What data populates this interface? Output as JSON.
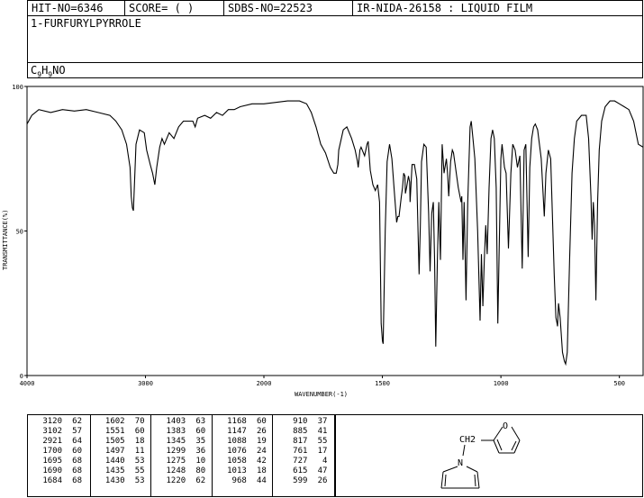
{
  "header": {
    "hit_no": "HIT-NO=6346",
    "score": "SCORE=  (  )",
    "sdbs_no": "SDBS-NO=22523",
    "ir_info": "IR-NIDA-26158 : LIQUID FILM"
  },
  "compound": {
    "name": "1-FURFURYLPYRROLE",
    "formula_parts": [
      "C",
      "9",
      "H",
      "9",
      "NO"
    ]
  },
  "chart_data": {
    "type": "line",
    "title": "",
    "xlabel": "WAVENUMBER(-1)",
    "ylabel": "TRANSMITTANCE(%)",
    "xlim": [
      4000,
      400
    ],
    "ylim": [
      0,
      100
    ],
    "x_ticks": [
      4000,
      3000,
      2000,
      1500,
      1000,
      500
    ],
    "y_ticks": [
      0,
      50,
      100
    ],
    "grid": false,
    "series": [
      {
        "points": [
          [
            4000,
            87
          ],
          [
            3960,
            90
          ],
          [
            3900,
            92
          ],
          [
            3800,
            91
          ],
          [
            3700,
            92
          ],
          [
            3600,
            91.5
          ],
          [
            3500,
            92
          ],
          [
            3400,
            91
          ],
          [
            3300,
            90
          ],
          [
            3250,
            88
          ],
          [
            3200,
            85
          ],
          [
            3160,
            80
          ],
          [
            3130,
            72
          ],
          [
            3120,
            62
          ],
          [
            3110,
            58
          ],
          [
            3102,
            57
          ],
          [
            3095,
            64
          ],
          [
            3080,
            80
          ],
          [
            3050,
            85
          ],
          [
            3010,
            84
          ],
          [
            2990,
            78
          ],
          [
            2960,
            73
          ],
          [
            2940,
            70
          ],
          [
            2921,
            66
          ],
          [
            2905,
            72
          ],
          [
            2880,
            79
          ],
          [
            2860,
            82
          ],
          [
            2840,
            80
          ],
          [
            2800,
            84
          ],
          [
            2760,
            82
          ],
          [
            2720,
            86
          ],
          [
            2680,
            88
          ],
          [
            2640,
            88
          ],
          [
            2600,
            88
          ],
          [
            2580,
            86
          ],
          [
            2560,
            89
          ],
          [
            2500,
            90
          ],
          [
            2450,
            89
          ],
          [
            2400,
            91
          ],
          [
            2350,
            90
          ],
          [
            2300,
            92
          ],
          [
            2250,
            92
          ],
          [
            2200,
            93
          ],
          [
            2100,
            94
          ],
          [
            2000,
            94
          ],
          [
            1950,
            94.5
          ],
          [
            1900,
            95
          ],
          [
            1850,
            95
          ],
          [
            1820,
            94
          ],
          [
            1800,
            91
          ],
          [
            1780,
            86
          ],
          [
            1760,
            80
          ],
          [
            1740,
            77
          ],
          [
            1720,
            72
          ],
          [
            1705,
            70
          ],
          [
            1700,
            70
          ],
          [
            1695,
            70
          ],
          [
            1688,
            73
          ],
          [
            1684,
            78
          ],
          [
            1665,
            85
          ],
          [
            1650,
            86
          ],
          [
            1630,
            82
          ],
          [
            1615,
            78
          ],
          [
            1605,
            74
          ],
          [
            1602,
            72
          ],
          [
            1595,
            78
          ],
          [
            1590,
            79
          ],
          [
            1575,
            76
          ],
          [
            1565,
            80
          ],
          [
            1560,
            81
          ],
          [
            1551,
            71
          ],
          [
            1540,
            66
          ],
          [
            1530,
            64
          ],
          [
            1520,
            66
          ],
          [
            1512,
            60
          ],
          [
            1505,
            18
          ],
          [
            1500,
            12
          ],
          [
            1497,
            11
          ],
          [
            1488,
            50
          ],
          [
            1480,
            74
          ],
          [
            1470,
            80
          ],
          [
            1460,
            75
          ],
          [
            1450,
            64
          ],
          [
            1440,
            53
          ],
          [
            1435,
            55
          ],
          [
            1430,
            55
          ],
          [
            1420,
            62
          ],
          [
            1415,
            65
          ],
          [
            1410,
            70
          ],
          [
            1405,
            69
          ],
          [
            1403,
            63
          ],
          [
            1398,
            65
          ],
          [
            1390,
            69
          ],
          [
            1385,
            67
          ],
          [
            1383,
            60
          ],
          [
            1375,
            73
          ],
          [
            1365,
            73
          ],
          [
            1355,
            68
          ],
          [
            1345,
            35
          ],
          [
            1340,
            52
          ],
          [
            1335,
            74
          ],
          [
            1325,
            80
          ],
          [
            1315,
            79
          ],
          [
            1305,
            56
          ],
          [
            1299,
            36
          ],
          [
            1292,
            56
          ],
          [
            1285,
            60
          ],
          [
            1280,
            40
          ],
          [
            1275,
            10
          ],
          [
            1268,
            40
          ],
          [
            1262,
            60
          ],
          [
            1255,
            40
          ],
          [
            1248,
            80
          ],
          [
            1240,
            70
          ],
          [
            1230,
            75
          ],
          [
            1225,
            70
          ],
          [
            1220,
            62
          ],
          [
            1212,
            74
          ],
          [
            1205,
            78
          ],
          [
            1200,
            77
          ],
          [
            1180,
            65
          ],
          [
            1168,
            60
          ],
          [
            1165,
            62
          ],
          [
            1160,
            40
          ],
          [
            1155,
            60
          ],
          [
            1147,
            26
          ],
          [
            1140,
            60
          ],
          [
            1130,
            86
          ],
          [
            1125,
            88
          ],
          [
            1118,
            82
          ],
          [
            1110,
            75
          ],
          [
            1098,
            50
          ],
          [
            1088,
            19
          ],
          [
            1082,
            42
          ],
          [
            1076,
            24
          ],
          [
            1070,
            40
          ],
          [
            1064,
            52
          ],
          [
            1058,
            42
          ],
          [
            1050,
            65
          ],
          [
            1042,
            82
          ],
          [
            1035,
            85
          ],
          [
            1028,
            82
          ],
          [
            1020,
            65
          ],
          [
            1013,
            18
          ],
          [
            1008,
            40
          ],
          [
            1000,
            75
          ],
          [
            995,
            80
          ],
          [
            985,
            72
          ],
          [
            978,
            70
          ],
          [
            968,
            44
          ],
          [
            958,
            70
          ],
          [
            950,
            80
          ],
          [
            940,
            78
          ],
          [
            930,
            72
          ],
          [
            920,
            76
          ],
          [
            910,
            37
          ],
          [
            902,
            78
          ],
          [
            895,
            80
          ],
          [
            885,
            41
          ],
          [
            878,
            72
          ],
          [
            870,
            82
          ],
          [
            862,
            86
          ],
          [
            855,
            87
          ],
          [
            845,
            85
          ],
          [
            830,
            75
          ],
          [
            817,
            55
          ],
          [
            810,
            70
          ],
          [
            800,
            78
          ],
          [
            790,
            75
          ],
          [
            775,
            35
          ],
          [
            768,
            20
          ],
          [
            763,
            18
          ],
          [
            761,
            17
          ],
          [
            757,
            25
          ],
          [
            750,
            20
          ],
          [
            740,
            8
          ],
          [
            732,
            5
          ],
          [
            727,
            4
          ],
          [
            720,
            8
          ],
          [
            710,
            40
          ],
          [
            700,
            70
          ],
          [
            690,
            82
          ],
          [
            680,
            88
          ],
          [
            660,
            90
          ],
          [
            640,
            90
          ],
          [
            630,
            82
          ],
          [
            620,
            62
          ],
          [
            615,
            47
          ],
          [
            610,
            60
          ],
          [
            605,
            52
          ],
          [
            599,
            26
          ],
          [
            592,
            60
          ],
          [
            585,
            78
          ],
          [
            575,
            88
          ],
          [
            560,
            93
          ],
          [
            540,
            95
          ],
          [
            520,
            95
          ],
          [
            500,
            94
          ],
          [
            480,
            93
          ],
          [
            460,
            92
          ],
          [
            440,
            88
          ],
          [
            420,
            80
          ],
          [
            400,
            79
          ]
        ]
      }
    ],
    "peak_table": [
      [
        [
          3120,
          62
        ],
        [
          3102,
          57
        ],
        [
          2921,
          64
        ],
        [
          1700,
          60
        ],
        [
          1695,
          68
        ],
        [
          1690,
          68
        ],
        [
          1684,
          68
        ]
      ],
      [
        [
          1602,
          70
        ],
        [
          1551,
          60
        ],
        [
          1505,
          18
        ],
        [
          1497,
          11
        ],
        [
          1440,
          53
        ],
        [
          1435,
          55
        ],
        [
          1430,
          53
        ]
      ],
      [
        [
          1403,
          63
        ],
        [
          1383,
          60
        ],
        [
          1345,
          35
        ],
        [
          1299,
          36
        ],
        [
          1275,
          10
        ],
        [
          1248,
          80
        ],
        [
          1220,
          62
        ]
      ],
      [
        [
          1168,
          60
        ],
        [
          1147,
          26
        ],
        [
          1088,
          19
        ],
        [
          1076,
          24
        ],
        [
          1058,
          42
        ],
        [
          1013,
          18
        ],
        [
          968,
          44
        ]
      ],
      [
        [
          910,
          37
        ],
        [
          885,
          41
        ],
        [
          817,
          55
        ],
        [
          761,
          17
        ],
        [
          727,
          4
        ],
        [
          615,
          47
        ],
        [
          599,
          26
        ]
      ]
    ]
  },
  "structure": {
    "ch2_label": "CH2",
    "o_label": "O",
    "n_label": "N"
  }
}
